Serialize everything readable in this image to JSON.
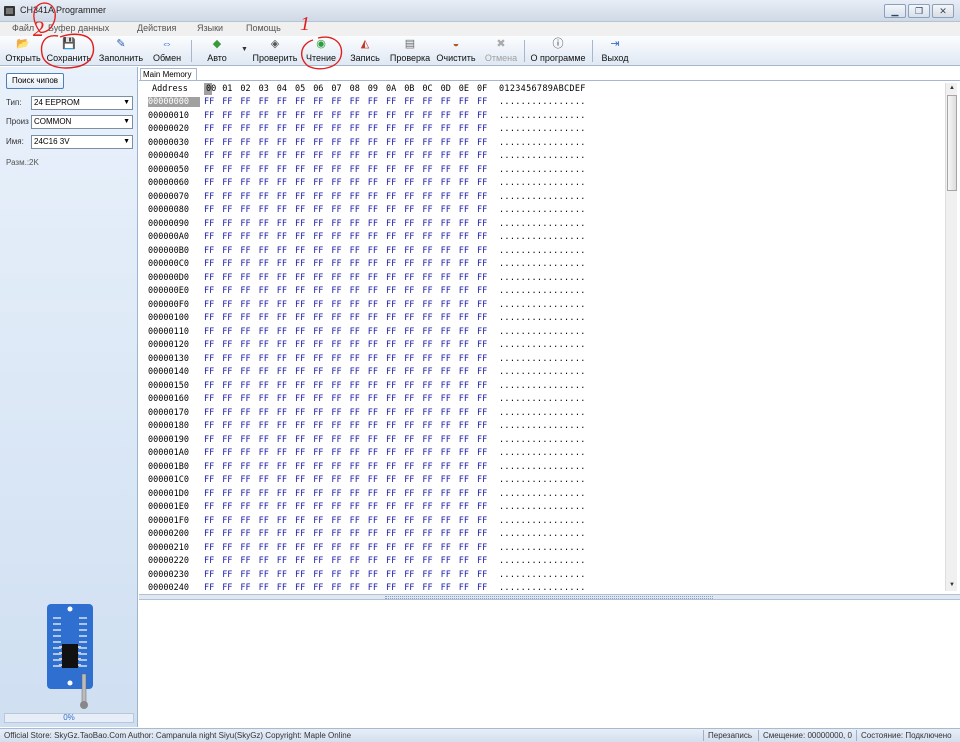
{
  "window": {
    "title": "CH341A Programmer",
    "buttons": [
      "minimize",
      "maximize",
      "close"
    ]
  },
  "menu": [
    "Файл",
    "Буфер данных",
    "Действия",
    "Языки",
    "Помощь"
  ],
  "toolbar": [
    {
      "label": "Открыть",
      "icon": "folder-icon",
      "glyph": "📂",
      "enabled": true
    },
    {
      "label": "Сохранить",
      "icon": "save-icon",
      "glyph": "💾",
      "enabled": true
    },
    {
      "label": "Заполнить",
      "icon": "fill-icon",
      "glyph": "✎",
      "enabled": true
    },
    {
      "label": "Обмен",
      "icon": "swap-icon",
      "glyph": "⇔",
      "enabled": true
    },
    {
      "label": "Авто",
      "icon": "auto-icon",
      "glyph": "◆",
      "enabled": true
    },
    {
      "label": "Проверить",
      "icon": "check-icon",
      "glyph": "◈",
      "enabled": true
    },
    {
      "label": "Чтение",
      "icon": "read-icon",
      "glyph": "◉",
      "enabled": true
    },
    {
      "label": "Запись",
      "icon": "write-icon",
      "glyph": "◭",
      "enabled": true
    },
    {
      "label": "Проверка",
      "icon": "verify-icon",
      "glyph": "▤",
      "enabled": true
    },
    {
      "label": "Очистить",
      "icon": "erase-icon",
      "glyph": "◒",
      "enabled": true
    },
    {
      "label": "Отмена",
      "icon": "cancel-icon",
      "glyph": "✖",
      "enabled": false
    },
    {
      "label": "О программе",
      "icon": "info-icon",
      "glyph": "ⓘ",
      "enabled": true
    },
    {
      "label": "Выход",
      "icon": "exit-icon",
      "glyph": "⇥",
      "enabled": true
    }
  ],
  "left_panel": {
    "search_button": "Поиск чипов",
    "type_label": "Тип:",
    "type_value": "24 EEPROM",
    "manufacturer_label": "Произ",
    "manufacturer_value": "COMMON",
    "name_label": "Имя:",
    "name_value": "24C16 3V",
    "size_text": "Разм.:2K",
    "progress_text": "0%",
    "progress": 0
  },
  "hex_view": {
    "tab": "Main Memory",
    "address_header": "Address",
    "columns": [
      "00",
      "01",
      "02",
      "03",
      "04",
      "05",
      "06",
      "07",
      "08",
      "09",
      "0A",
      "0B",
      "0C",
      "0D",
      "0E",
      "0F"
    ],
    "ascii_header": "0123456789ABCDEF",
    "rows": [
      "00000000",
      "00000010",
      "00000020",
      "00000030",
      "00000040",
      "00000050",
      "00000060",
      "00000070",
      "00000080",
      "00000090",
      "000000A0",
      "000000B0",
      "000000C0",
      "000000D0",
      "000000E0",
      "000000F0",
      "00000100",
      "00000110",
      "00000120",
      "00000130",
      "00000140",
      "00000150",
      "00000160",
      "00000170",
      "00000180",
      "00000190",
      "000001A0",
      "000001B0",
      "000001C0",
      "000001D0",
      "000001E0",
      "000001F0",
      "00000200",
      "00000210",
      "00000220",
      "00000230",
      "00000240"
    ],
    "byte_value": "FF",
    "ascii_row": "................"
  },
  "status": {
    "left": "Official Store: SkyGz.TaoBao.Com Author: Campanula night Siyu(SkyGz) Copyright: Maple Online",
    "mode": "Перезапись",
    "offset": "Смещение: 00000000, 0",
    "state": "Состояние: Подключено"
  },
  "annotations": [
    "1",
    "2"
  ],
  "colors": {
    "byte_text": "#1a1aa8",
    "annotation": "#e02020",
    "progress_text": "#2f6fd0"
  }
}
